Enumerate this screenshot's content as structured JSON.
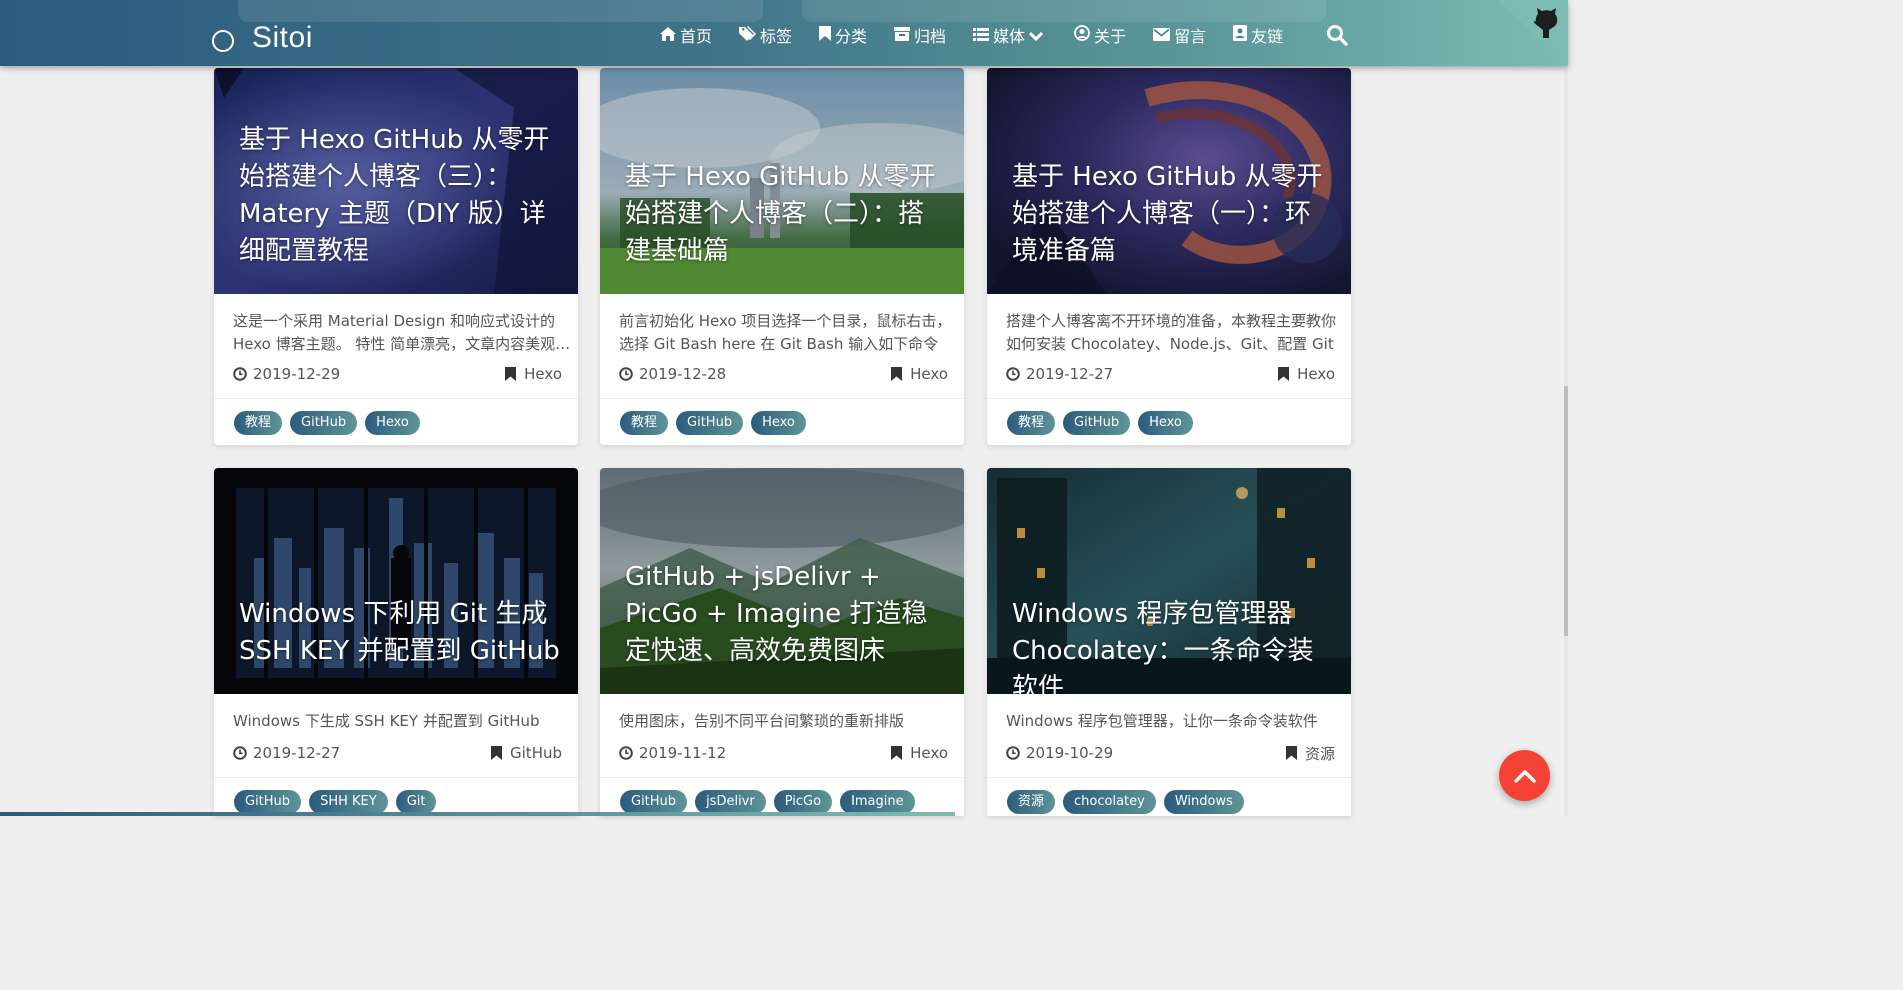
{
  "header": {
    "brand": "Sitoi",
    "nav": [
      {
        "label": "首页",
        "icon": "home-icon"
      },
      {
        "label": "标签",
        "icon": "tags-icon"
      },
      {
        "label": "分类",
        "icon": "bookmark-icon"
      },
      {
        "label": "归档",
        "icon": "archive-icon"
      },
      {
        "label": "媒体",
        "icon": "list-icon"
      },
      {
        "label": "关于",
        "icon": "user-circle-icon"
      },
      {
        "label": "留言",
        "icon": "envelope-icon"
      },
      {
        "label": "友链",
        "icon": "address-book-icon"
      }
    ],
    "search_icon": "search-icon",
    "github_icon": "github-octocat-icon",
    "colors": {
      "gradient_start": "#2c5b7e",
      "gradient_end": "#7dbcb4"
    }
  },
  "posts": [
    {
      "title": "基于 Hexo GitHub 从零开始搭建个人博客（三）：Matery 主题（DIY 版）详细配置教程",
      "summary": "这是一个采用 Material Design 和响应式设计的 Hexo 博客主题。 特性 简单漂亮，文章内容美观易读",
      "date": "2019-12-29",
      "category": "Hexo",
      "tags": [
        "教程",
        "GitHub",
        "Hexo"
      ]
    },
    {
      "title": "基于 Hexo GitHub 从零开始搭建个人博客（二）：搭建基础篇",
      "summary": "前言初始化 Hexo 项目选择一个目录，鼠标右击，选择 Git Bash here 在 Git Bash 输入如下命令",
      "date": "2019-12-28",
      "category": "Hexo",
      "tags": [
        "教程",
        "GitHub",
        "Hexo"
      ]
    },
    {
      "title": "基于 Hexo GitHub 从零开始搭建个人博客（一）：环境准备篇",
      "summary": "搭建个人博客离不开环境的准备，本教程主要教你如何安装 Chocolatey、Node.js、Git、配置 Git",
      "date": "2019-12-27",
      "category": "Hexo",
      "tags": [
        "教程",
        "GitHub",
        "Hexo"
      ]
    },
    {
      "title": "Windows 下利用 Git 生成 SSH KEY 并配置到 GitHub",
      "summary": "Windows 下生成 SSH KEY 并配置到 GitHub",
      "date": "2019-12-27",
      "category": "GitHub",
      "tags": [
        "GitHub",
        "SHH KEY",
        "Git"
      ]
    },
    {
      "title": "GitHub + jsDelivr + PicGo + Imagine 打造稳定快速、高效免费图床",
      "summary": "使用图床，告别不同平台间繁琐的重新排版",
      "date": "2019-11-12",
      "category": "Hexo",
      "tags": [
        "GitHub",
        "jsDelivr",
        "PicGo",
        "Imagine"
      ]
    },
    {
      "title": "Windows 程序包管理器 Chocolatey：一条命令装软件",
      "summary": "Windows 程序包管理器，让你一条命令装软件",
      "date": "2019-10-29",
      "category": "资源",
      "tags": [
        "资源",
        "chocolatey",
        "Windows"
      ]
    }
  ],
  "back_to_top_icon": "chevron-up-icon"
}
